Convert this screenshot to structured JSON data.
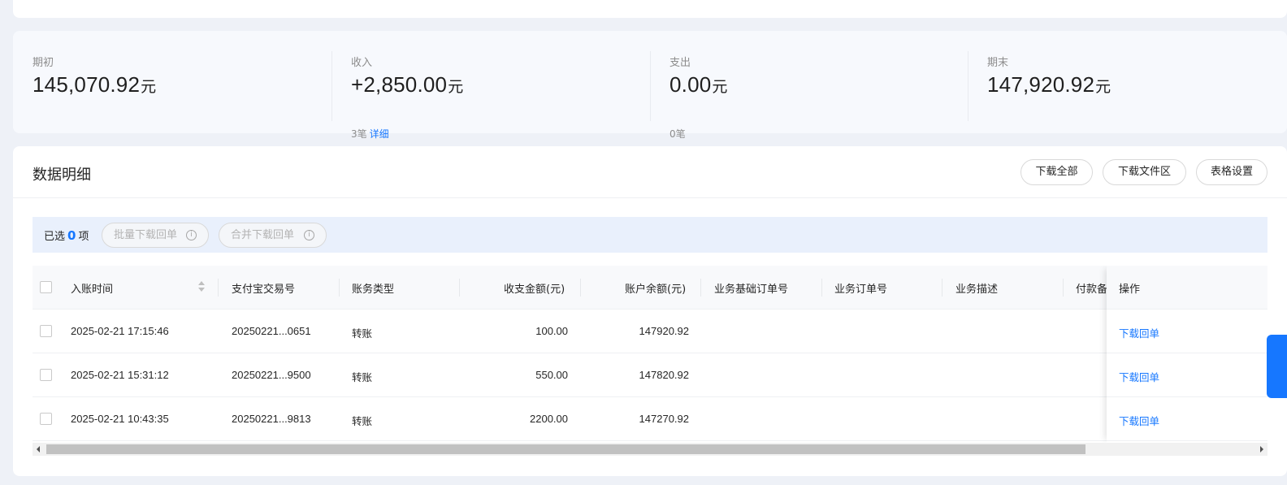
{
  "summary": {
    "opening": {
      "label": "期初",
      "amount": "145,070.92",
      "unit": "元"
    },
    "income": {
      "label": "收入",
      "amount": "+2,850.00",
      "unit": "元",
      "count": "3笔",
      "link": "详细"
    },
    "expense": {
      "label": "支出",
      "amount": "0.00",
      "unit": "元",
      "count": "0笔"
    },
    "closing": {
      "label": "期末",
      "amount": "147,920.92",
      "unit": "元"
    }
  },
  "detail": {
    "title": "数据明细",
    "buttons": {
      "download_all": "下载全部",
      "download_files": "下载文件区",
      "table_settings": "表格设置"
    }
  },
  "selection": {
    "prefix": "已选",
    "count": "0",
    "suffix": "项",
    "batch_download": "批量下载回单",
    "merge_download": "合并下载回单",
    "info_icon": "info-circle-icon"
  },
  "table": {
    "columns": {
      "time": "入账时间",
      "trade_no": "支付宝交易号",
      "type": "账务类型",
      "amount": "收支金额(元)",
      "balance": "账户余额(元)",
      "base_order": "业务基础订单号",
      "order": "业务订单号",
      "desc": "业务描述",
      "payment_note": "付款备",
      "action": "操作"
    },
    "rows": [
      {
        "time": "2025-02-21 17:15:46",
        "trade_no": "20250221...0651",
        "type": "转账",
        "amount": "100.00",
        "balance": "147920.92",
        "action": "下载回单"
      },
      {
        "time": "2025-02-21 15:31:12",
        "trade_no": "20250221...9500",
        "type": "转账",
        "amount": "550.00",
        "balance": "147820.92",
        "action": "下载回单"
      },
      {
        "time": "2025-02-21 10:43:35",
        "trade_no": "20250221...9813",
        "type": "转账",
        "amount": "2200.00",
        "balance": "147270.92",
        "action": "下载回单"
      }
    ]
  },
  "colors": {
    "accent": "#1677ff",
    "page_bg": "#eef1f7"
  }
}
